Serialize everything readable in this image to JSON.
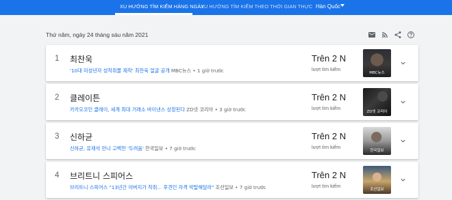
{
  "nav": {
    "tabs": [
      {
        "label": "XU HƯỚNG TÌM KIẾM HÀNG NGÀY"
      },
      {
        "label": "XU HƯỚNG TÌM KIẾM THEO THỜI GIAN THỰC"
      }
    ],
    "country": "Hàn Quốc",
    "accent": "#1a73e8"
  },
  "header": {
    "date": "Thứ năm, ngày 24 tháng sáu năm 2021",
    "icons": [
      "email-icon",
      "rss-icon",
      "share-icon",
      "help-icon"
    ]
  },
  "trends": [
    {
      "rank": "1",
      "title": "최찬욱",
      "article": "'10대 미성년자 성착취물 제작' 최찬욱 얼굴 공개",
      "source_time": "MBC뉴스 • 1 giờ trước",
      "count": "Trên 2 N",
      "count_label": "lượt tìm kiếm",
      "thumb_source": "MBC뉴스"
    },
    {
      "rank": "2",
      "title": "클레이튼",
      "article": "카카오코인 클레이, 세계 최대 거래소 바이낸스 상장된다",
      "source_time": "ZD넷 코리아 • 3 giờ trước",
      "count": "Trên 2 N",
      "count_label": "lượt tìm kiếm",
      "thumb_source": "ZD넷 코리아"
    },
    {
      "rank": "3",
      "title": "신하균",
      "article": "신하균, 유재석 만나 고백한 '두려움'",
      "source_time": "한국일보 • 7 giờ trước",
      "count": "Trên 2 N",
      "count_label": "lượt tìm kiếm",
      "thumb_source": "한국일보"
    },
    {
      "rank": "4",
      "title": "브리트니 스피어스",
      "article": "브리트니 스피어스 \"13년간 아버지가 착취... 후견인 자격 박탈해달라\"",
      "source_time": "조선일보 • 7 giờ trước",
      "count": "Trên 2 N",
      "count_label": "lượt tìm kiếm",
      "thumb_source": "조선일보"
    }
  ]
}
